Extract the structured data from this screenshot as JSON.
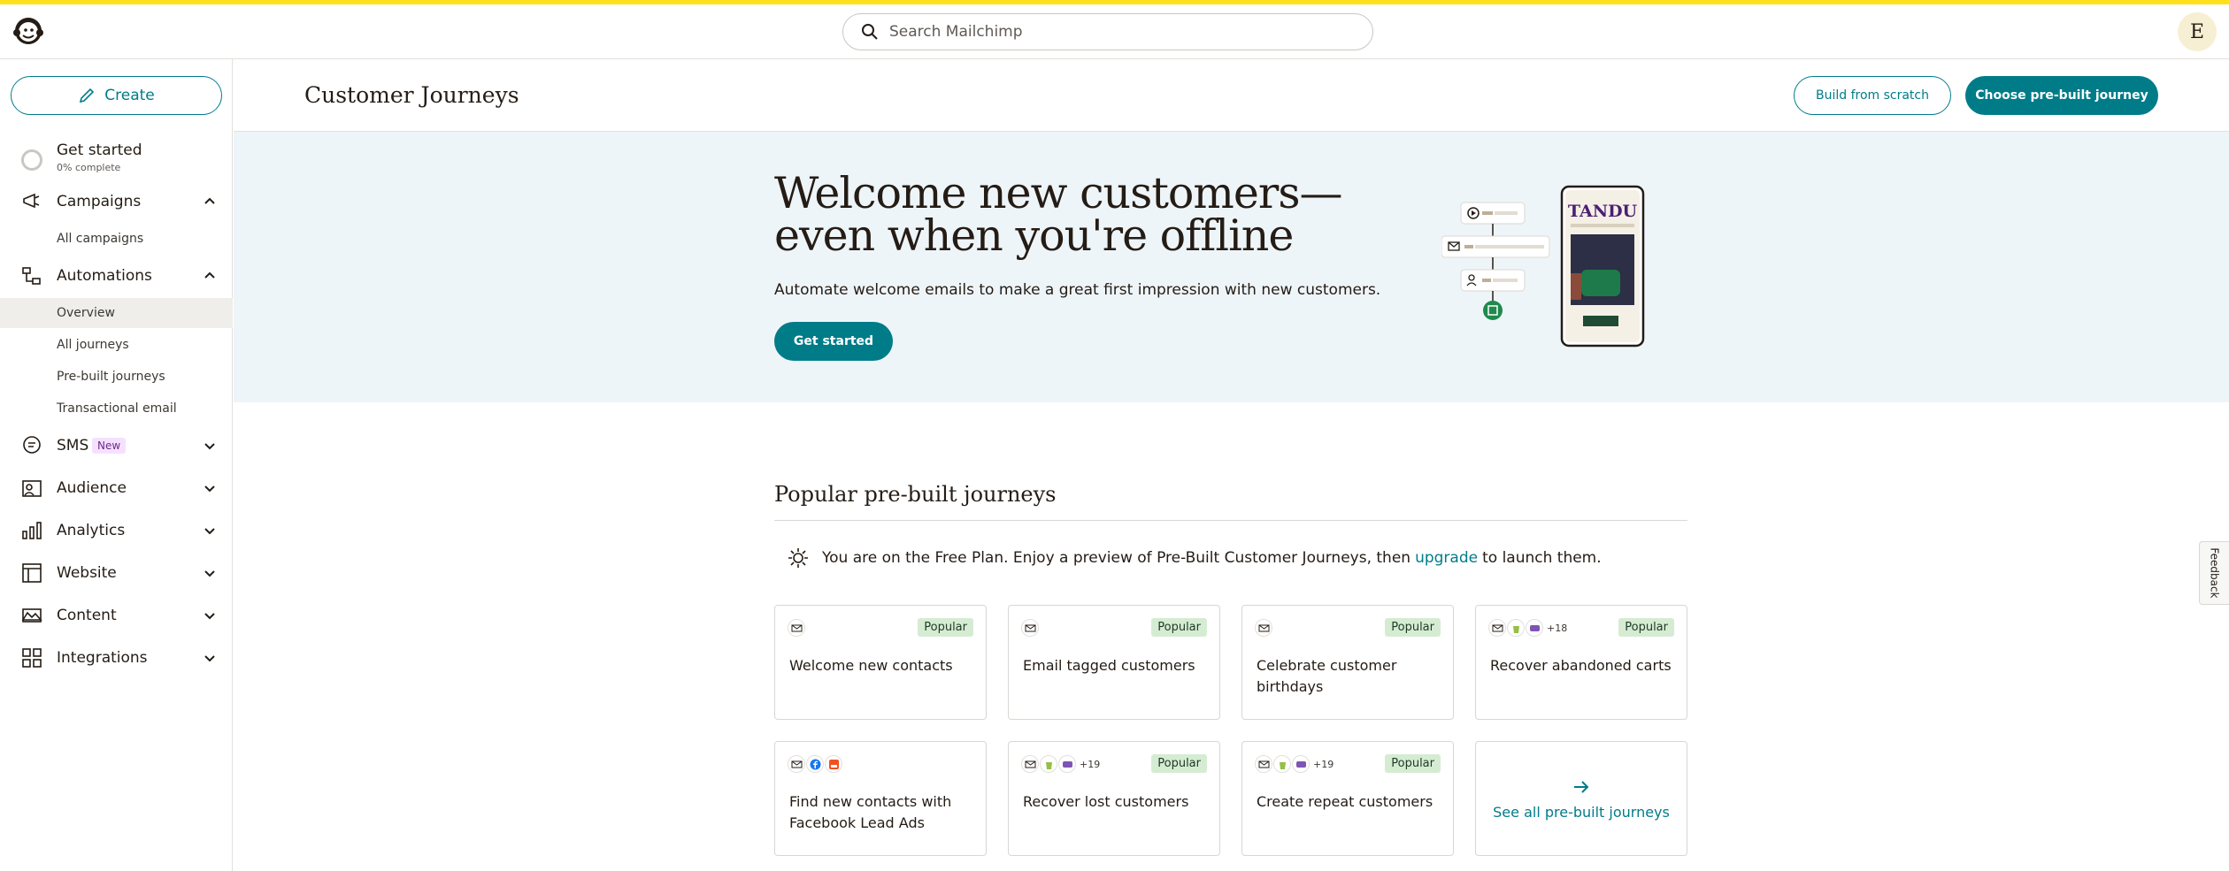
{
  "app": {
    "name": "Mailchimp",
    "accent": "#007c89",
    "brand": "#ffe01b"
  },
  "search": {
    "placeholder": "Search Mailchimp"
  },
  "user": {
    "avatar_initial": "E"
  },
  "sidebar": {
    "create_label": "Create",
    "get_started": {
      "title": "Get started",
      "progress_text": "0% complete",
      "progress": 0
    },
    "campaigns": {
      "label": "Campaigns",
      "subitems": [
        "All campaigns"
      ]
    },
    "automations": {
      "label": "Automations",
      "subitems": [
        "Overview",
        "All journeys",
        "Pre-built journeys",
        "Transactional email"
      ]
    },
    "sms": {
      "label": "SMS",
      "badge": "New"
    },
    "audience": {
      "label": "Audience"
    },
    "analytics": {
      "label": "Analytics"
    },
    "website": {
      "label": "Website"
    },
    "content": {
      "label": "Content"
    },
    "integrations": {
      "label": "Integrations"
    }
  },
  "header": {
    "title": "Customer Journeys",
    "build_from_scratch": "Build from scratch",
    "choose_prebuilt": "Choose pre-built journey"
  },
  "hero": {
    "title_line1": "Welcome new customers—",
    "title_line2": "even when you're offline",
    "subtitle": "Automate welcome emails to make a great first impression with new customers.",
    "cta": "Get started",
    "phone_brand": "TANDU"
  },
  "popular": {
    "title": "Popular pre-built journeys",
    "plan_note_before": "You are on the Free Plan. Enjoy a preview of Pre-Built Customer Journeys, then",
    "plan_note_link": "upgrade",
    "plan_note_after": "to launch them.",
    "badge": "Popular",
    "cards": [
      {
        "title": "Welcome new contacts",
        "popular": true,
        "icons": [
          "email-icon"
        ],
        "more": ""
      },
      {
        "title": "Email tagged customers",
        "popular": true,
        "icons": [
          "email-icon"
        ],
        "more": ""
      },
      {
        "title": "Celebrate customer birthdays",
        "popular": true,
        "icons": [
          "email-icon"
        ],
        "more": ""
      },
      {
        "title": "Recover abandoned carts",
        "popular": true,
        "icons": [
          "email-icon",
          "shopify-icon",
          "woo-icon"
        ],
        "more": "+18"
      },
      {
        "title": "Find new contacts with Facebook Lead Ads",
        "popular": false,
        "icons": [
          "email-icon",
          "facebook-icon",
          "lead-ads-icon"
        ],
        "more": ""
      },
      {
        "title": "Recover lost customers",
        "popular": true,
        "icons": [
          "email-icon",
          "shopify-icon",
          "woo-icon"
        ],
        "more": "+19"
      },
      {
        "title": "Create repeat customers",
        "popular": true,
        "icons": [
          "email-icon",
          "shopify-icon",
          "woo-icon"
        ],
        "more": "+19"
      }
    ],
    "see_all": "See all pre-built journeys"
  },
  "feedback": {
    "label": "Feedback"
  }
}
